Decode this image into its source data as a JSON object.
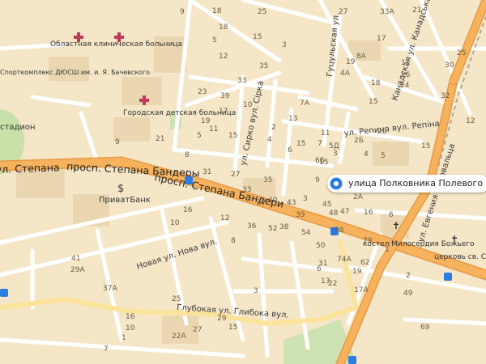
{
  "map": {
    "marker_label": "улица Полковника Полевого",
    "streets": {
      "bandery_1": "просп. Степана Бандеры",
      "bandery_2": "просп. Степана Бандери",
      "bandery_left": "ул. Степана",
      "novaya": "Новая ул. Нова вул.",
      "glubokaya": "Глубокая ул. Глибока вул.",
      "repina": "ул. Репина вул. Репіна",
      "syrko": "ул. Сирко вул. Сірка",
      "gutsulskaya": "Гуцульская ул.",
      "kanadskaya": "Канадская ул. Канадська вул.",
      "evgeniya": "ул. Евгения Коновальца"
    },
    "pois": {
      "oblast_hospital": "Областная клиническая больница",
      "children_hospital": "Городская детская больница",
      "sport_complex": "Спорткомплекс ДЮСШ им. и. Я. Бачевского",
      "stadium": "стадион",
      "privatbank": "ПриватБанк",
      "kostel": "костел Милосердия Божьего",
      "church": "церковь св. Софии"
    },
    "house_numbers": [
      "18",
      "9",
      "25",
      "18",
      "15",
      "5",
      "12",
      "3",
      "35",
      "33",
      "23",
      "39",
      "17",
      "19",
      "11",
      "15",
      "5",
      "13",
      "10",
      "6",
      "2",
      "4",
      "8",
      "9",
      "21",
      "31",
      "27",
      "33",
      "35",
      "40",
      "37",
      "38",
      "36",
      "52",
      "39",
      "43",
      "48",
      "54",
      "58",
      "45",
      "47",
      "50",
      "8",
      "12",
      "16",
      "10",
      "2Б",
      "33А",
      "27",
      "21",
      "8А",
      "4А",
      "19",
      "17",
      "15",
      "18",
      "11",
      "26",
      "24",
      "25",
      "30",
      "32",
      "20",
      "15",
      "12",
      "15",
      "3",
      "6Б",
      "7",
      "9",
      "11",
      "15",
      "7А",
      "5Д",
      "5",
      "3",
      "4",
      "6",
      "16",
      "2А",
      "1",
      "2",
      "49",
      "69",
      "79",
      "74А",
      "31",
      "62",
      "17А",
      "19",
      "22",
      "13",
      "6",
      "3",
      "27",
      "25",
      "41",
      "29А",
      "37А",
      "16",
      "10",
      "1",
      "7",
      "22А",
      "15",
      "29"
    ]
  }
}
